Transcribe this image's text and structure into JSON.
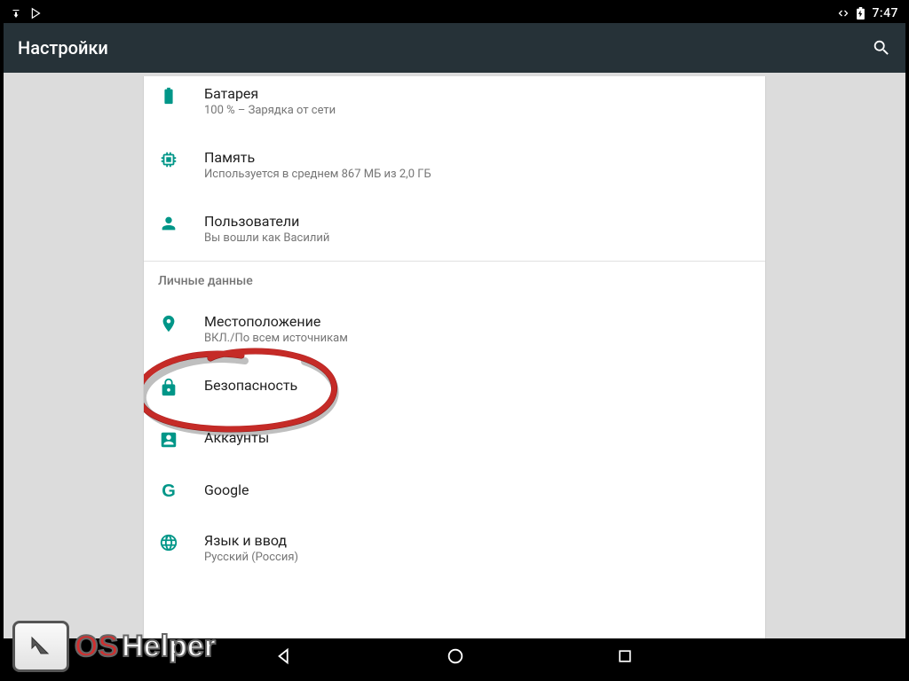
{
  "statusbar": {
    "time": "7:47"
  },
  "appbar": {
    "title": "Настройки"
  },
  "items": {
    "battery": {
      "title": "Батарея",
      "subtitle": "100 % – Зарядка от сети"
    },
    "memory": {
      "title": "Память",
      "subtitle": "Используется в среднем 867 МБ из 2,0 ГБ"
    },
    "users": {
      "title": "Пользователи",
      "subtitle": "Вы вошли как Василий"
    },
    "section_personal": "Личные данные",
    "location": {
      "title": "Местоположение",
      "subtitle": "ВКЛ./По всем источникам"
    },
    "security": {
      "title": "Безопасность"
    },
    "accounts": {
      "title": "Аккаунты"
    },
    "google": {
      "title": "Google"
    },
    "language": {
      "title": "Язык и ввод",
      "subtitle": "Русский (Россия)"
    }
  },
  "watermark": {
    "os": "OS",
    "helper": "Helper"
  }
}
